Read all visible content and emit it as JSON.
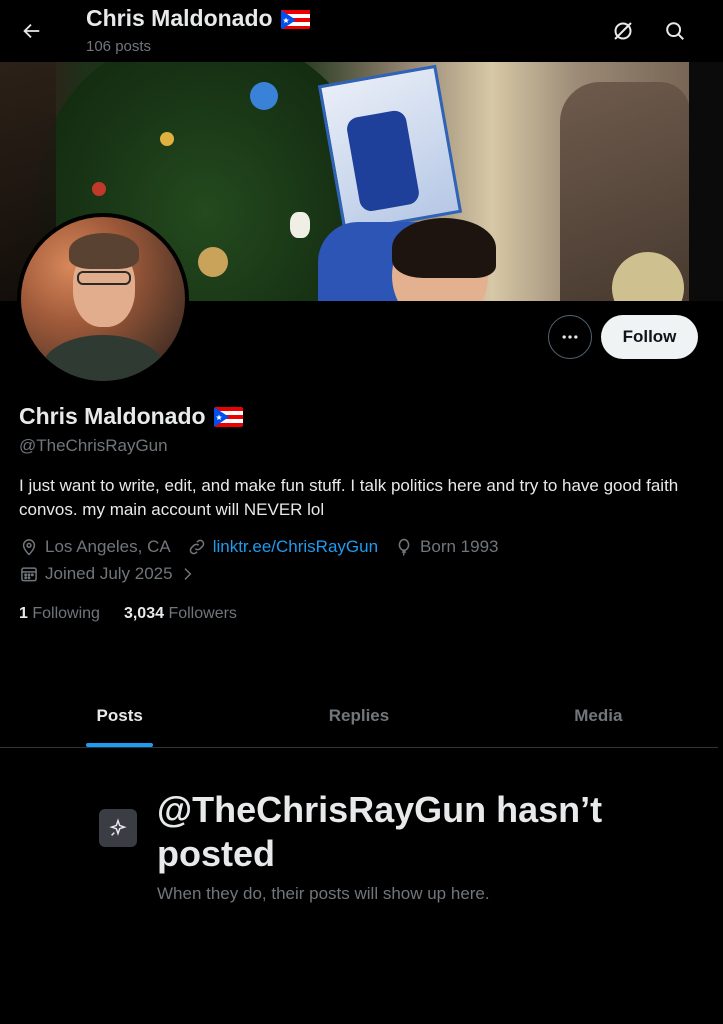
{
  "header": {
    "title": "Chris Maldonado",
    "post_count": "106 posts"
  },
  "profile": {
    "name": "Chris Maldonado",
    "handle": "@TheChrisRayGun",
    "bio": "I just want to write, edit, and make fun stuff. I talk politics here and try to have good faith convos. my main account will NEVER lol",
    "location": "Los Angeles, CA",
    "website": "linktr.ee/ChrisRayGun",
    "birth": "Born 1993",
    "joined": "Joined July 2025",
    "following_count": "1",
    "following_label": "Following",
    "followers_count": "3,034",
    "followers_label": "Followers",
    "follow_button": "Follow"
  },
  "tabs": [
    {
      "label": "Posts",
      "active": true
    },
    {
      "label": "Replies",
      "active": false
    },
    {
      "label": "Media",
      "active": false
    }
  ],
  "empty_state": {
    "title": "@TheChrisRayGun hasn’t posted",
    "subtitle": "When they do, their posts will show up here."
  },
  "colors": {
    "accent": "#1d9bf0",
    "secondary_text": "#71767b",
    "primary_text": "#e7e9ea",
    "background": "#000000"
  },
  "icons": [
    "back-arrow-icon",
    "grok-icon",
    "search-icon",
    "more-icon",
    "location-icon",
    "link-icon",
    "balloon-icon",
    "calendar-icon",
    "chevron-right-icon",
    "sparkle-icon",
    "puerto-rico-flag-icon"
  ]
}
